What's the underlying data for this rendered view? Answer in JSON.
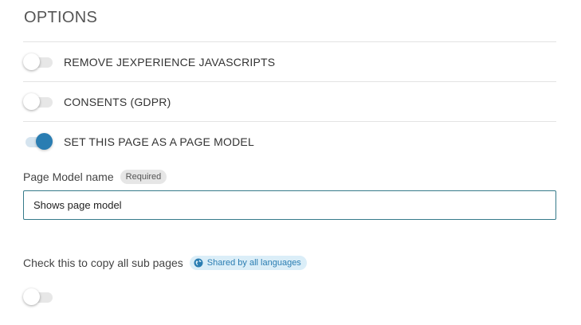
{
  "options": {
    "title": "OPTIONS",
    "items": [
      {
        "label": "REMOVE JEXPERIENCE JAVASCRIPTS",
        "enabled": false
      },
      {
        "label": "CONSENTS (GDPR)",
        "enabled": false
      },
      {
        "label": "SET THIS PAGE AS A PAGE MODEL",
        "enabled": true
      }
    ]
  },
  "page_model": {
    "label": "Page Model name",
    "required_badge": "Required",
    "value": "Shows page model"
  },
  "copy_subpages": {
    "label": "Check this to copy all sub pages",
    "shared_badge": "Shared by all languages",
    "shared_icon": "globe-icon",
    "enabled": false
  },
  "colors": {
    "accent": "#2a7db2",
    "input_border": "#357a8a",
    "shared_badge_bg": "#dbeef8"
  }
}
